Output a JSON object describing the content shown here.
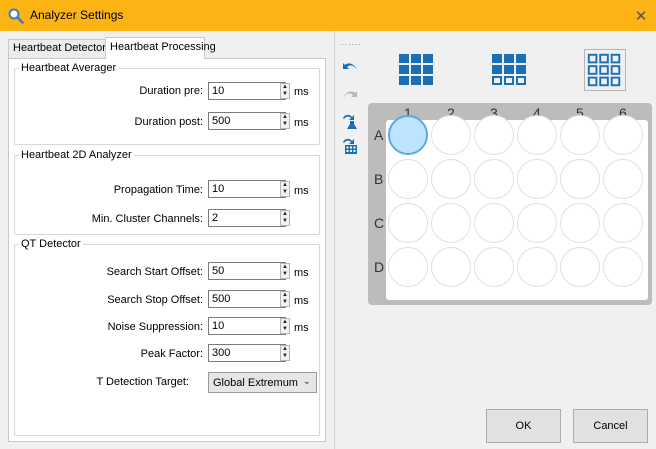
{
  "window": {
    "title": "Analyzer Settings",
    "close_glyph": "✕"
  },
  "tabs": [
    {
      "label": "Heartbeat Detector",
      "active": false
    },
    {
      "label": "Heartbeat Processing",
      "active": true
    }
  ],
  "groups": {
    "averager": {
      "title": "Heartbeat Averager",
      "rows": [
        {
          "label": "Duration pre:",
          "value": "10",
          "unit": "ms"
        },
        {
          "label": "Duration post:",
          "value": "500",
          "unit": "ms"
        }
      ]
    },
    "analyzer2d": {
      "title": "Heartbeat 2D Analyzer",
      "rows": [
        {
          "label": "Propagation Time:",
          "value": "10",
          "unit": "ms"
        },
        {
          "label": "Min. Cluster Channels:",
          "value": "2",
          "unit": ""
        }
      ]
    },
    "qt": {
      "title": "QT Detector",
      "rows": [
        {
          "label": "Search Start Offset:",
          "value": "50",
          "unit": "ms"
        },
        {
          "label": "Search Stop Offset:",
          "value": "500",
          "unit": "ms"
        },
        {
          "label": "Noise Suppression:",
          "value": "10",
          "unit": "ms"
        },
        {
          "label": "Peak Factor:",
          "value": "300",
          "unit": ""
        }
      ],
      "target_label": "T Detection Target:",
      "target_value": "Global Extremum"
    }
  },
  "toolbar": {
    "icons": [
      "undo-icon",
      "redo-icon",
      "flask-icon",
      "plate-grid-icon"
    ],
    "dots": "......"
  },
  "layouts": {
    "options": [
      "grid-solid-icon",
      "grid-mixed-icon",
      "grid-outline-icon"
    ],
    "selected_index": 2
  },
  "plate": {
    "columns": [
      "1",
      "2",
      "3",
      "4",
      "5",
      "6"
    ],
    "rows": [
      "A",
      "B",
      "C",
      "D"
    ],
    "selected_well": "A1"
  },
  "buttons": {
    "ok": "OK",
    "cancel": "Cancel"
  },
  "colors": {
    "titlebar": "#fbb413",
    "accent": "#1a6fb5",
    "well_selected": "#bde3ff",
    "plate_frame": "#bcbcbc"
  }
}
